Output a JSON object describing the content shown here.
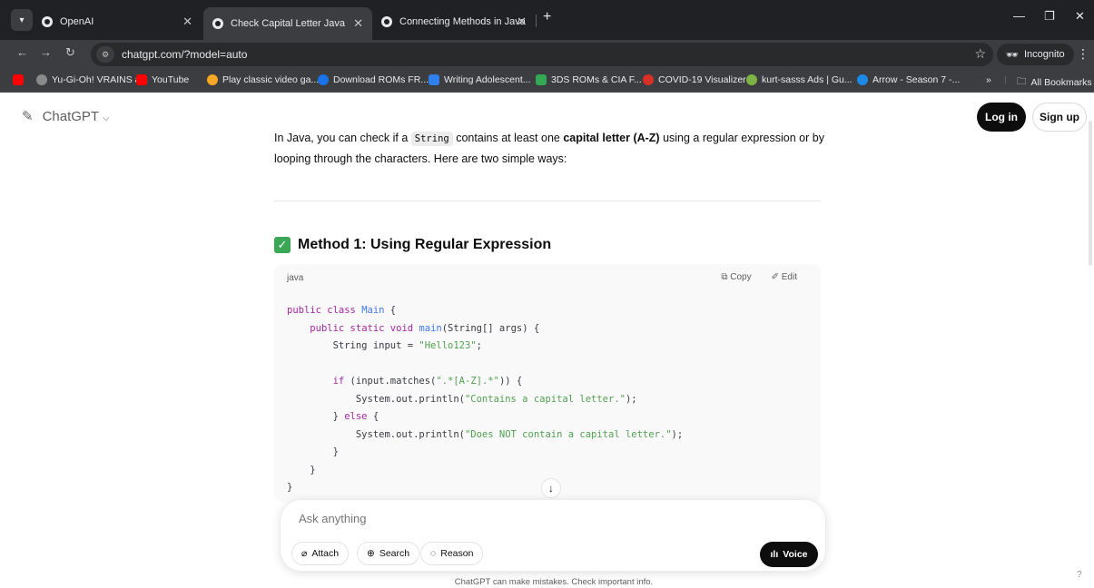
{
  "browser": {
    "tabs": [
      {
        "title": "OpenAI",
        "active": false
      },
      {
        "title": "Check Capital Letter Java",
        "active": true
      },
      {
        "title": "Connecting Methods in Java",
        "active": false
      }
    ],
    "new_tab": "+",
    "url": "chatgpt.com/?model=auto",
    "incognito_label": "Incognito",
    "bookmarks": [
      {
        "label": "Yu-Gi-Oh! VRAINS a...",
        "color": "#6f6f6f"
      },
      {
        "label": "YouTube",
        "color": "#ff0000"
      },
      {
        "label": "Play classic video ga...",
        "color": "#f5a623"
      },
      {
        "label": "Download ROMs FR...",
        "color": "#1a73e8"
      },
      {
        "label": "Writing Adolescent...",
        "color": "#2f80ed"
      },
      {
        "label": "3DS ROMs & CIA F...",
        "color": "#34a853"
      },
      {
        "label": "COVID-19 Visualizer",
        "color": "#d93025"
      },
      {
        "label": "kurt-sasss Ads | Gu...",
        "color": "#7cb342"
      },
      {
        "label": "Arrow - Season 7 -...",
        "color": "#1e88e5"
      }
    ],
    "bookmarks_overflow": "»",
    "all_bookmarks": "All Bookmarks"
  },
  "header": {
    "brand": "ChatGPT",
    "login": "Log in",
    "signup": "Sign up"
  },
  "content": {
    "intro_before": "In Java, you can check if a ",
    "intro_code": "String",
    "intro_middle": " contains at least one ",
    "intro_bold": "capital letter (A-Z)",
    "intro_after": " using a regular expression or by looping through the characters. Here are two simple ways:",
    "method_heading": "Method 1: Using Regular Expression",
    "code_lang": "java",
    "copy_label": "Copy",
    "edit_label": "Edit"
  },
  "composer": {
    "placeholder": "Ask anything",
    "attach": "Attach",
    "search": "Search",
    "reason": "Reason",
    "voice": "Voice"
  },
  "footer": {
    "disclaimer": "ChatGPT can make mistakes. Check important info.",
    "help": "?"
  }
}
